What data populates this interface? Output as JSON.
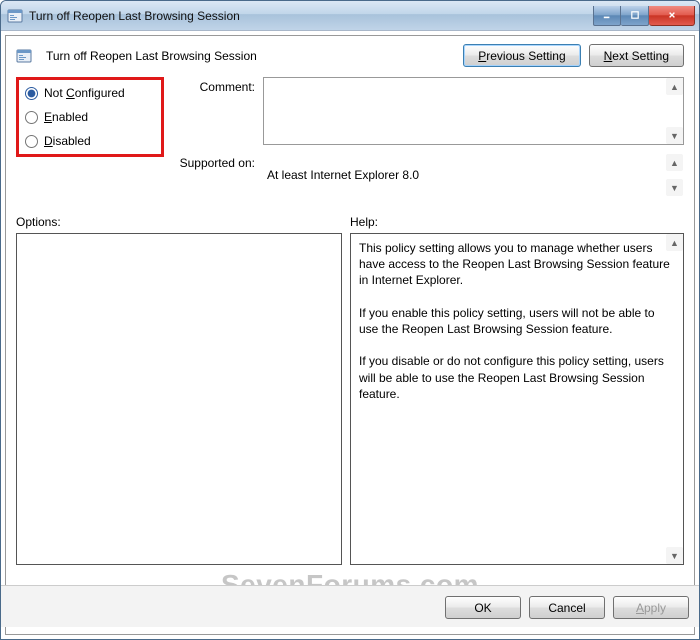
{
  "window": {
    "title": "Turn off Reopen Last Browsing Session"
  },
  "header": {
    "policy_title": "Turn off Reopen Last Browsing Session",
    "previous": "Previous Setting",
    "next": "Next Setting"
  },
  "state": {
    "radios": {
      "not_configured": "Not Configured",
      "enabled": "Enabled",
      "disabled": "Disabled"
    },
    "selected": "not_configured"
  },
  "labels": {
    "comment": "Comment:",
    "supported": "Supported on:",
    "options": "Options:",
    "help": "Help:"
  },
  "fields": {
    "comment_value": "",
    "supported_value": "At least Internet Explorer 8.0"
  },
  "help": "This policy setting allows you to manage whether users have access to the Reopen Last Browsing Session feature in Internet Explorer.\n\nIf you enable this policy setting, users will not be able to use the Reopen Last Browsing Session feature.\n\nIf you disable or do not configure this policy setting, users will be able to use the Reopen Last Browsing Session feature.",
  "footer": {
    "ok": "OK",
    "cancel": "Cancel",
    "apply": "Apply"
  },
  "watermark": "SevenForums.com"
}
